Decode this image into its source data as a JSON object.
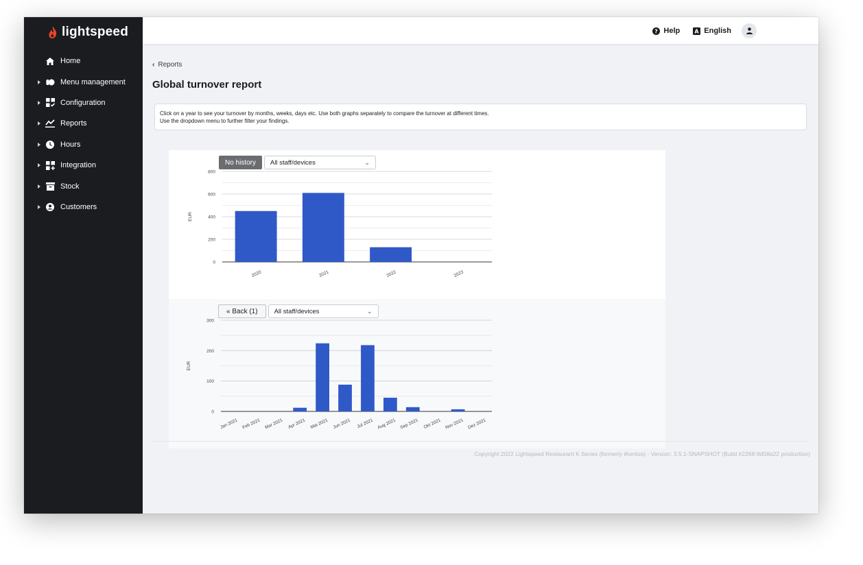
{
  "brand": {
    "logo_text": "lightspeed",
    "accent": "#e8452c"
  },
  "sidebar": {
    "items": [
      {
        "label": "Home",
        "icon": "home-icon",
        "expandable": false
      },
      {
        "label": "Menu management",
        "icon": "menu-management-icon",
        "expandable": true
      },
      {
        "label": "Configuration",
        "icon": "configuration-icon",
        "expandable": true
      },
      {
        "label": "Reports",
        "icon": "reports-icon",
        "expandable": true
      },
      {
        "label": "Hours",
        "icon": "clock-icon",
        "expandable": true
      },
      {
        "label": "Integration",
        "icon": "integration-icon",
        "expandable": true
      },
      {
        "label": "Stock",
        "icon": "stock-icon",
        "expandable": true
      },
      {
        "label": "Customers",
        "icon": "customers-icon",
        "expandable": true
      }
    ]
  },
  "topbar": {
    "help_label": "Help",
    "language_label": "English"
  },
  "main": {
    "breadcrumb": "Reports",
    "title": "Global turnover report",
    "info_line1": "Click on a year to see your turnover by months, weeks, days etc. Use both graphs separately to compare the turnover at different times.",
    "info_line2": "Use the dropdown menu to further filter your findings."
  },
  "chart1_controls": {
    "button_label": "No history",
    "select_value": "All staff/devices"
  },
  "chart2_controls": {
    "button_label": "« Back (1)",
    "select_value": "All staff/devices"
  },
  "chart_data": [
    {
      "type": "bar",
      "categories": [
        "2020",
        "2021",
        "2022",
        "2023"
      ],
      "values": [
        450,
        610,
        130,
        0
      ],
      "ylabel": "EUR",
      "ylim": [
        0,
        800
      ],
      "yticks": [
        0,
        200,
        400,
        600,
        800
      ],
      "grid": true,
      "color": "#3059c8"
    },
    {
      "type": "bar",
      "categories": [
        "Jan 2021",
        "Feb 2021",
        "Mar 2021",
        "Apr 2021",
        "Mai 2021",
        "Jun 2021",
        "Jul 2021",
        "Aug 2021",
        "Sep 2021",
        "Okt 2021",
        "Nov 2021",
        "Dez 2021"
      ],
      "values": [
        0,
        0,
        0,
        12,
        224,
        88,
        218,
        45,
        14,
        0,
        7,
        0
      ],
      "ylabel": "EUR",
      "ylim": [
        0,
        300
      ],
      "yticks": [
        0,
        100,
        200,
        300
      ],
      "grid": true,
      "color": "#3059c8"
    }
  ],
  "footer": {
    "copyright": "Copyright 2022 Lightspeed Restaurant K Series (formerly iKentoo) - Version: 3.5.1-SNAPSHOT (Build #2268-9d58a22 production)"
  }
}
